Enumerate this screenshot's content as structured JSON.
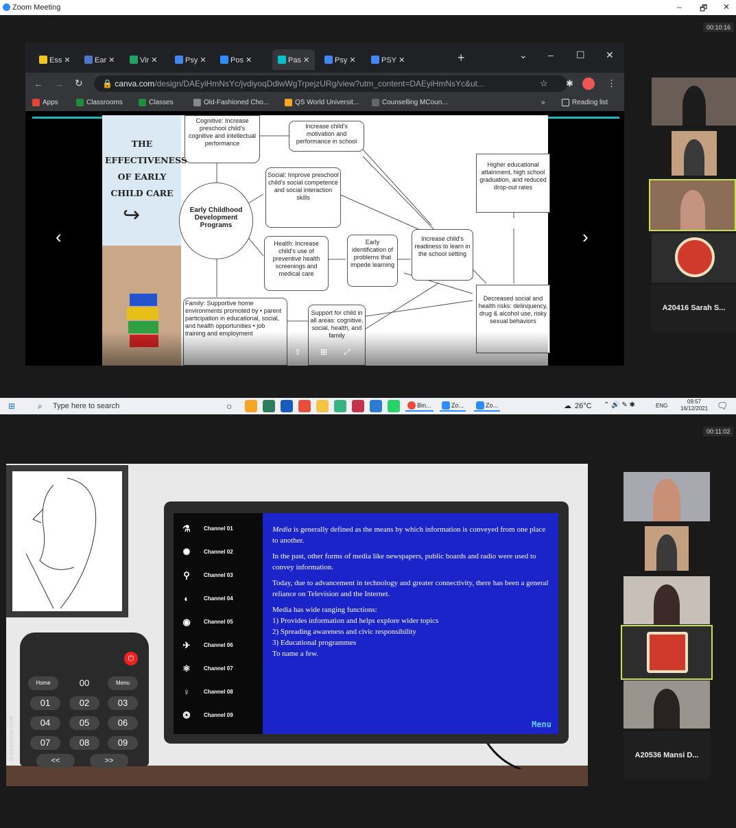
{
  "window": {
    "title": "Zoom Meeting",
    "controls": [
      "–",
      "🗗",
      "✕"
    ]
  },
  "top_meeting": {
    "timer": "00:10:16",
    "browser": {
      "tabs": [
        {
          "label": "Ess ✕",
          "color": "#f5c518"
        },
        {
          "label": "Ear ✕",
          "color": "#4a78c2"
        },
        {
          "label": "Vir ✕",
          "color": "#1fa463"
        },
        {
          "label": "Psy ✕",
          "color": "#4285f4"
        },
        {
          "label": "Pos ✕",
          "color": "#2d8cff"
        },
        {
          "label": "Pas ✕",
          "color": "#00c4cc"
        },
        {
          "label": "Psy ✕",
          "color": "#4285f4"
        },
        {
          "label": "PSY ✕",
          "color": "#4285f4"
        }
      ],
      "new_tab": "+",
      "url_domain": "canva.com",
      "url_path": "/design/DAEyiHmNsYc/jvdiyoqDdlwWgTrpejzURg/view?utm_content=DAEyiHmNsYc&ut...",
      "bookmarks": [
        {
          "label": "Apps",
          "color": "#ea4335"
        },
        {
          "label": "Classrooms",
          "color": "#1e8e3e"
        },
        {
          "label": "Classes",
          "color": "#1e8e3e"
        },
        {
          "label": "Old-Fashioned Cho...",
          "color": "#888"
        },
        {
          "label": "QS World Universit...",
          "color": "#f5a623"
        },
        {
          "label": "Counselling MCoun...",
          "color": "#666"
        }
      ],
      "reading_list": "Reading list",
      "more": "»"
    },
    "slide": {
      "title_lines": [
        "THE",
        "EFFECTIVENESS",
        "OF EARLY",
        "CHILD CARE"
      ],
      "center": "Early Childhood Development Programs",
      "cognitive": "Cognitive: Increase preschool child's cognitive and intellectual performance",
      "motivation": "Increase child's motivation and performance in school",
      "social": "Social: Improve preschool child's social competence and social interaction skills",
      "health": "Health: Increase child's use of preventive health screenings and medical care",
      "early_id": "Early identification of problems that impede learning",
      "readiness": "Increase child's readiness to learn in the school setting",
      "higher_ed": "Higher educational attainment, high school graduation, and reduced drop-out rates",
      "decreased": "Decreased social and health risks: delinquency, drug & alcohol use, risky sexual behaviors",
      "family": "Family: Supportive home environments promoted by • parent participation in educational, social, and health opportunities • job training and employment",
      "support": "Support for child in all areas: cognitive, social, health, and family"
    },
    "participant_name": "A20416 Sarah S...",
    "taskbar": {
      "search_placeholder": "Type here to search",
      "tabs": [
        "Bin...",
        "Zo...",
        "Zo..."
      ],
      "weather": "26°C",
      "lang": "ENG",
      "time": "09:57",
      "date": "16/12/2021"
    }
  },
  "bottom_meeting": {
    "timer": "00:11:02",
    "channels": [
      "Channel 01",
      "Channel 02",
      "Channel 03",
      "Channel 04",
      "Channel 05",
      "Channel 06",
      "Channel 07",
      "Channel 08",
      "Channel 09"
    ],
    "content": {
      "p1_em": "Media",
      "p1": " is generally defined as the means by which information is conveyed from one place to another.",
      "p2": "In the past, other forms of media  like newspapers, public boards and radio were  used to convey information.",
      "p3": "Today, due to advancement in technology and greater connectivity, there has been a general reliance on Television and the Internet.",
      "p4_lines": [
        "Media has wide ranging functions:",
        "1) Provides information and helps explore wider topics",
        "2) Spreading awareness and civic responsibility",
        "3) Educational programmes",
        "To name a few."
      ],
      "menu": "Menu"
    },
    "remote": {
      "home": "Home",
      "menu": "Menu",
      "zero": "00",
      "keys": [
        "01",
        "02",
        "03",
        "04",
        "05",
        "06",
        "07",
        "08",
        "09"
      ],
      "prev": "<<",
      "next": ">>",
      "watermark": "SLIDESMANIA.COM"
    },
    "participant_name": "A20536 Mansi D..."
  }
}
